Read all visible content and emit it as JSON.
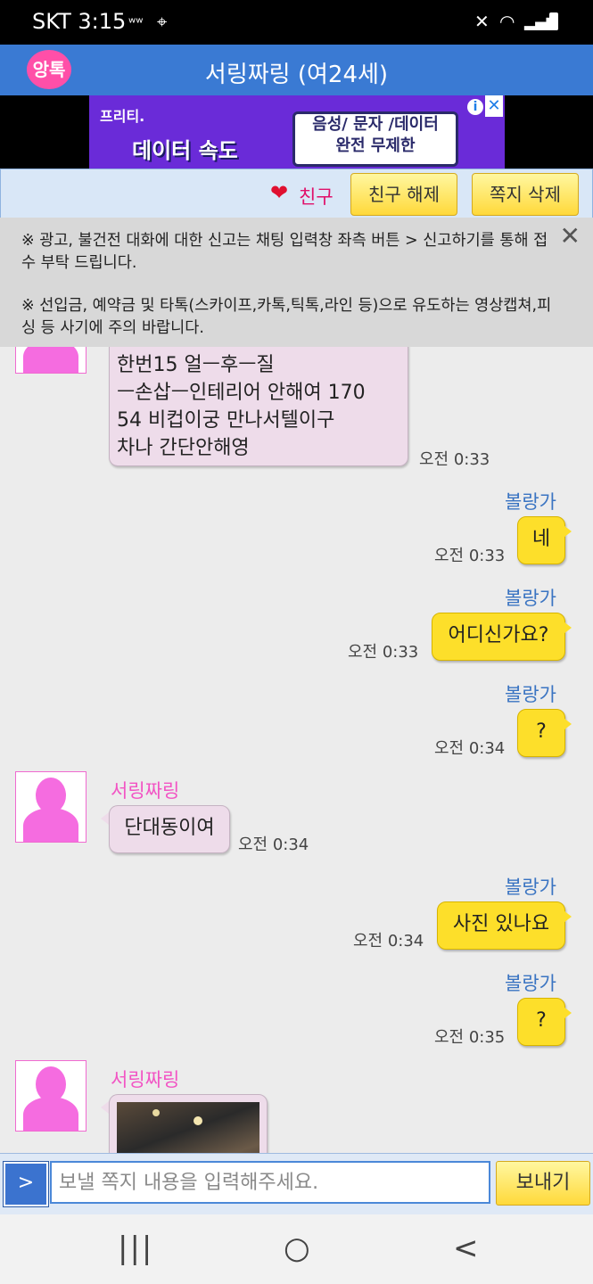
{
  "status": {
    "carrier_time": "SKT 3:15",
    "icons": [
      "signal-icon",
      "location-icon",
      "mute-icon",
      "wifi-icon",
      "battery-icon"
    ]
  },
  "header": {
    "logo": "앙톡",
    "title": "서링짜링 (여24세)"
  },
  "ad": {
    "brand": "프리티.",
    "left_text": "데이터 속도",
    "box_line1": "음성/ 문자 /데이터",
    "box_line2": "완전 무제한",
    "info": "i",
    "close": "✕"
  },
  "friend_bar": {
    "friend_label": "친구",
    "unfriend_label": "친구 해제",
    "delete_label": "쪽지 삭제"
  },
  "notice": {
    "line1": "※ 광고, 불건전 대화에 대한 신고는 채팅 입력창 좌측 버튼 > 신고하기를 통해 접수 부탁 드립니다.",
    "line2": "※ 선입금, 예약금 및 타톡(스카이프,카톡,틱톡,라인 등)으로 유도하는 영상캡쳐,피싱 등 사기에 주의 바랍니다."
  },
  "chat": {
    "other_name": "서링짜링",
    "me_name": "볼랑가",
    "messages": [
      {
        "from": "other",
        "lines": [
          "한번15 얼ㅡ후ㅡ질",
          "ㅡ손삽ㅡ인테리어 안해여 170",
          "54 비컵이궁  만나서텔이구",
          "차나 간단안해영"
        ],
        "time": "오전 0:33"
      },
      {
        "from": "me",
        "text": "네",
        "time": "오전 0:33"
      },
      {
        "from": "me",
        "text": "어디신가요?",
        "time": "오전 0:33"
      },
      {
        "from": "me",
        "text": "?",
        "time": "오전 0:34"
      },
      {
        "from": "other",
        "text": "단대동이여",
        "time": "오전 0:34"
      },
      {
        "from": "me",
        "text": "사진 있나요",
        "time": "오전 0:34"
      },
      {
        "from": "me",
        "text": "?",
        "time": "오전 0:35"
      },
      {
        "from": "other",
        "image": true
      }
    ]
  },
  "input": {
    "plus": ">",
    "placeholder": "보낼 쪽지 내용을 입력해주세요.",
    "send_label": "보내기"
  },
  "navbar": {
    "recent": "|||",
    "home": "○",
    "back": "<"
  }
}
